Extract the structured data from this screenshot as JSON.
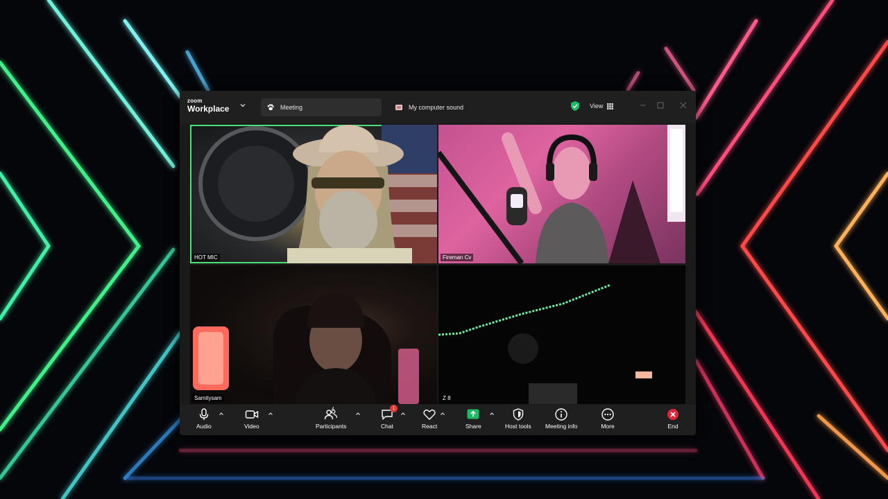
{
  "window": {
    "logo_small": "zoom",
    "logo_big": "Workplace",
    "tabs": [
      {
        "label": "Meeting",
        "icon": "paw-icon"
      },
      {
        "label": "My computer sound",
        "icon": "computer-sound-icon"
      }
    ],
    "view_label": "View"
  },
  "participants_tiles": [
    {
      "name": "HOT MIC",
      "active_speaker": true
    },
    {
      "name": "Fireman Cv"
    },
    {
      "name": "Samitysam"
    },
    {
      "name": "Z 8"
    }
  ],
  "toolbar": {
    "audio": "Audio",
    "video": "Video",
    "participants": "Participants",
    "participants_count": "4",
    "chat": "Chat",
    "chat_badge": "1",
    "react": "React",
    "share": "Share",
    "host_tools": "Host tools",
    "meeting_info": "Meeting info",
    "more": "More",
    "end": "End"
  },
  "colors": {
    "active_speaker_border": "#4ee07a",
    "share_green": "#1dbb62",
    "end_red": "#e0263a",
    "badge_red": "#e03a3a"
  }
}
